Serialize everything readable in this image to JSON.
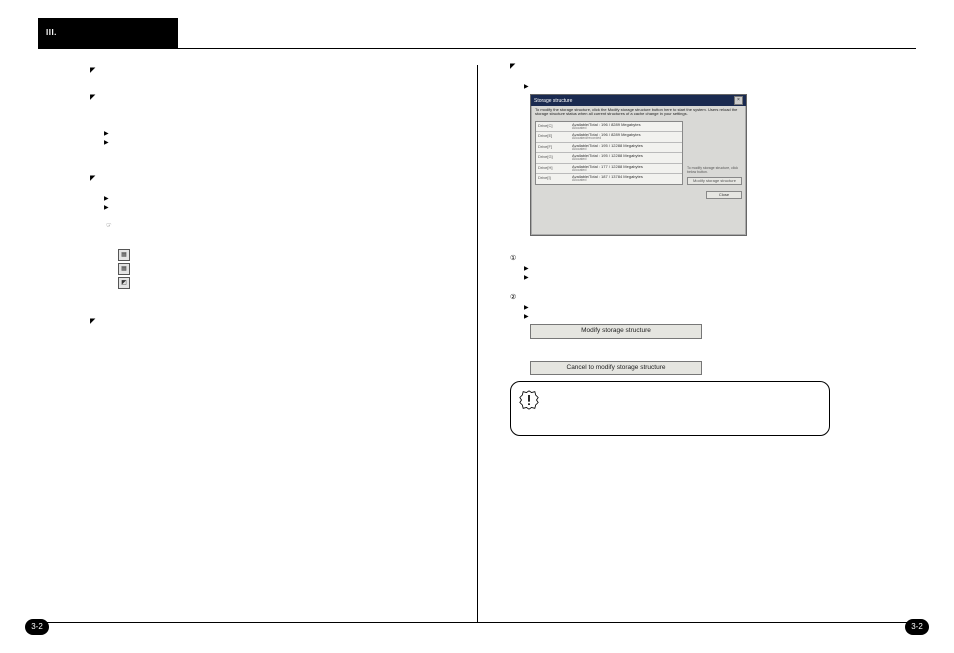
{
  "chapter": {
    "label": "III."
  },
  "page_number": "3-2",
  "left": {
    "sec1": {
      "text": [
        "",
        ""
      ]
    },
    "sec2": {
      "text": "",
      "sub": [
        "",
        ""
      ]
    },
    "sec3": {
      "text": "",
      "sub": [
        "",
        ""
      ],
      "note_marker": "☞",
      "note": "",
      "icon_rows": [
        {
          "glyph": "▦",
          "text": ""
        },
        {
          "glyph": "▦",
          "text": ""
        },
        {
          "glyph": "◩",
          "text": ""
        }
      ]
    },
    "sec4": {
      "text": ""
    }
  },
  "right": {
    "sec1": {
      "text": "",
      "sub": [
        ""
      ]
    },
    "dialog": {
      "title": "Storage structure",
      "close": "×",
      "desc": "To modify the storage structure, click the Modify storage structure button here to start the system. Users reload the storage structure status when all current structures of a cache change in your settings.",
      "rows": [
        {
          "drive": "Drive[C]",
          "line1": "Available/Total : 196 / 8289 Megabytes",
          "line2": "Allocated"
        },
        {
          "drive": "Drive[E]",
          "line1": "Available/Total : 196 / 8289 Megabytes",
          "line2": "Allocated/recorded"
        },
        {
          "drive": "Drive[F]",
          "line1": "Available/Total : 195 / 12288 Megabytes",
          "line2": "Allocated"
        },
        {
          "drive": "Drive[G]",
          "line1": "Available/Total : 195 / 12288 Megabytes",
          "line2": "Allocated"
        },
        {
          "drive": "Drive[H]",
          "line1": "Available/Total : 177 / 12288 Megabytes",
          "line2": "Allocated"
        },
        {
          "drive": "Drive[I]",
          "line1": "Available/Total : 187 / 13784 Megabytes",
          "line2": "Allocated"
        }
      ],
      "side_hint": "To modify storage structure, click below button.",
      "side_button": "Modify storage structure",
      "close_btn": "Close"
    },
    "step1": {
      "marker": "①",
      "sub": [
        "",
        ""
      ]
    },
    "step2": {
      "marker": "②",
      "sub": [
        "",
        ""
      ]
    },
    "btn_modify": "Modify storage structure",
    "after_modify": "",
    "btn_cancel": "Cancel to modify storage structure",
    "after_cancel": "",
    "warning": {
      "text": ""
    }
  }
}
